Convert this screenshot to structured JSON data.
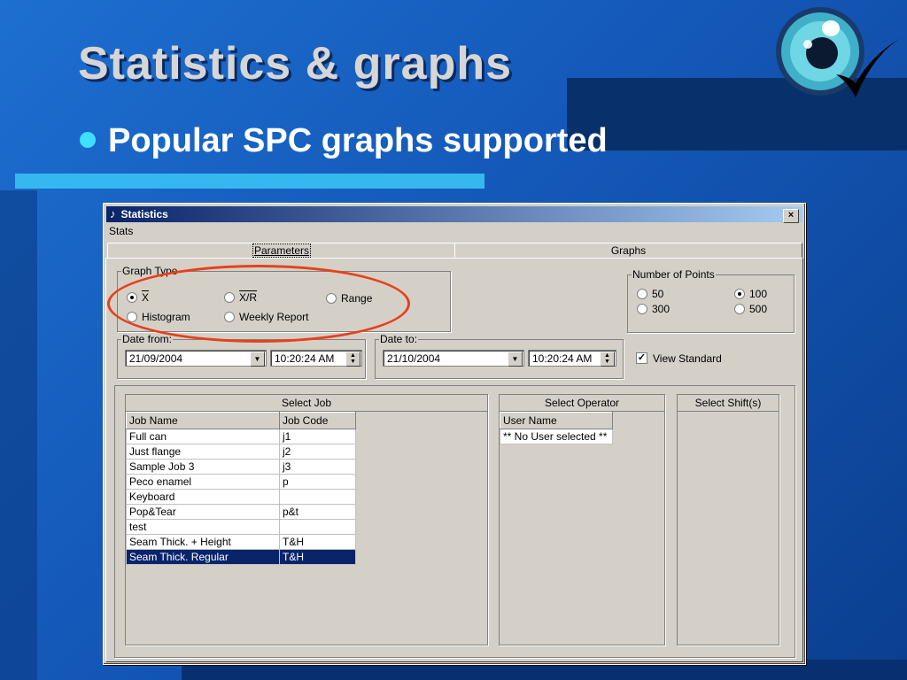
{
  "slide": {
    "title": "Statistics & graphs",
    "bullet": "Popular SPC graphs supported"
  },
  "window": {
    "title": "Statistics",
    "close_label": "×",
    "menu": [
      "Stats"
    ],
    "tabs": [
      {
        "label": "Parameters",
        "active": true
      },
      {
        "label": "Graphs",
        "active": false
      }
    ]
  },
  "graph_type": {
    "label": "Graph Type",
    "options": [
      {
        "label": "X",
        "selected": true
      },
      {
        "label": "X/R",
        "selected": false
      },
      {
        "label": "Range",
        "selected": false
      },
      {
        "label": "Histogram",
        "selected": false
      },
      {
        "label": "Weekly Report",
        "selected": false
      }
    ]
  },
  "points": {
    "label": "Number of Points",
    "options": [
      {
        "label": "50",
        "selected": false
      },
      {
        "label": "100",
        "selected": true
      },
      {
        "label": "300",
        "selected": false
      },
      {
        "label": "500",
        "selected": false
      }
    ]
  },
  "date_from": {
    "label": "Date from:",
    "date": "21/09/2004",
    "time": "10:20:24 AM"
  },
  "date_to": {
    "label": "Date to:",
    "date": "21/10/2004",
    "time": "10:20:24 AM"
  },
  "view_standard": {
    "label": "View Standard",
    "checked": true
  },
  "jobs": {
    "header": "Select Job",
    "columns": [
      "Job Name",
      "Job Code"
    ],
    "rows": [
      [
        "Full can",
        "j1"
      ],
      [
        "Just flange",
        "j2"
      ],
      [
        "Sample Job 3",
        "j3"
      ],
      [
        "Peco enamel",
        "p"
      ],
      [
        "Keyboard",
        ""
      ],
      [
        "Pop&Tear",
        "p&t"
      ],
      [
        "test",
        ""
      ],
      [
        "Seam Thick. + Height",
        "T&H"
      ],
      [
        "Seam Thick. Regular",
        "T&H"
      ]
    ],
    "selected_row": 8
  },
  "operators": {
    "header": "Select Operator",
    "columns": [
      "User Name"
    ],
    "rows": [
      [
        "** No User selected **"
      ]
    ]
  },
  "shifts": {
    "header": "Select Shift(s)"
  },
  "colors": {
    "title_bar_start": "#0a246a",
    "highlight_ellipse": "#e8401a",
    "slide_bg": "#1458b8"
  },
  "logo_icon": "eye-checkmark-logo"
}
